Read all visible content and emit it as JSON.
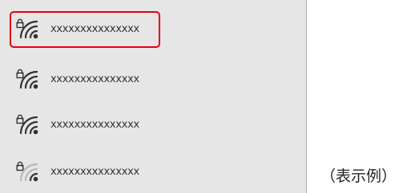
{
  "network_list": {
    "items": [
      {
        "ssid": "xxxxxxxxxxxxxxx",
        "locked": true,
        "signal": 3,
        "selected": true
      },
      {
        "ssid": "xxxxxxxxxxxxxxx",
        "locked": true,
        "signal": 3,
        "selected": false
      },
      {
        "ssid": "xxxxxxxxxxxxxxx",
        "locked": true,
        "signal": 3,
        "selected": false
      },
      {
        "ssid": "xxxxxxxxxxxxxxx",
        "locked": true,
        "signal": 1,
        "selected": false
      }
    ],
    "icon": "wifi-lock-icon"
  },
  "caption": "（表示例）",
  "colors": {
    "panel_background": "#e6e6e6",
    "selection_border": "#e60012",
    "icon_active": "#333333",
    "icon_inactive": "#b8b8b8"
  }
}
